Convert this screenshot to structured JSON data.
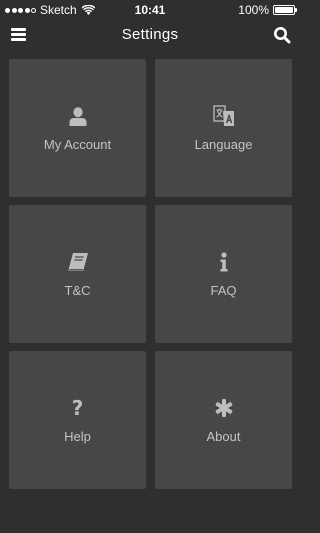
{
  "status_bar": {
    "carrier": "Sketch",
    "time": "10:41",
    "battery": "100%",
    "battery_level": 1.0,
    "signal_bars_filled": 4,
    "signal_bars_total": 5
  },
  "nav": {
    "title": "Settings",
    "menu_icon": "hamburger-menu-icon",
    "search_icon": "search-icon"
  },
  "tiles": [
    {
      "label": "My Account",
      "icon": "user-icon"
    },
    {
      "label": "Language",
      "icon": "translate-icon"
    },
    {
      "label": "T&C",
      "icon": "book-icon"
    },
    {
      "label": "FAQ",
      "icon": "info-icon"
    },
    {
      "label": "Help",
      "icon": "question-mark-icon"
    },
    {
      "label": "About",
      "icon": "asterisk-icon"
    }
  ],
  "colors": {
    "background": "#2f2f2f",
    "tile": "#474747",
    "icon": "#bdbdbd",
    "label": "#c4c4c4",
    "nav_text": "#ffffff"
  }
}
